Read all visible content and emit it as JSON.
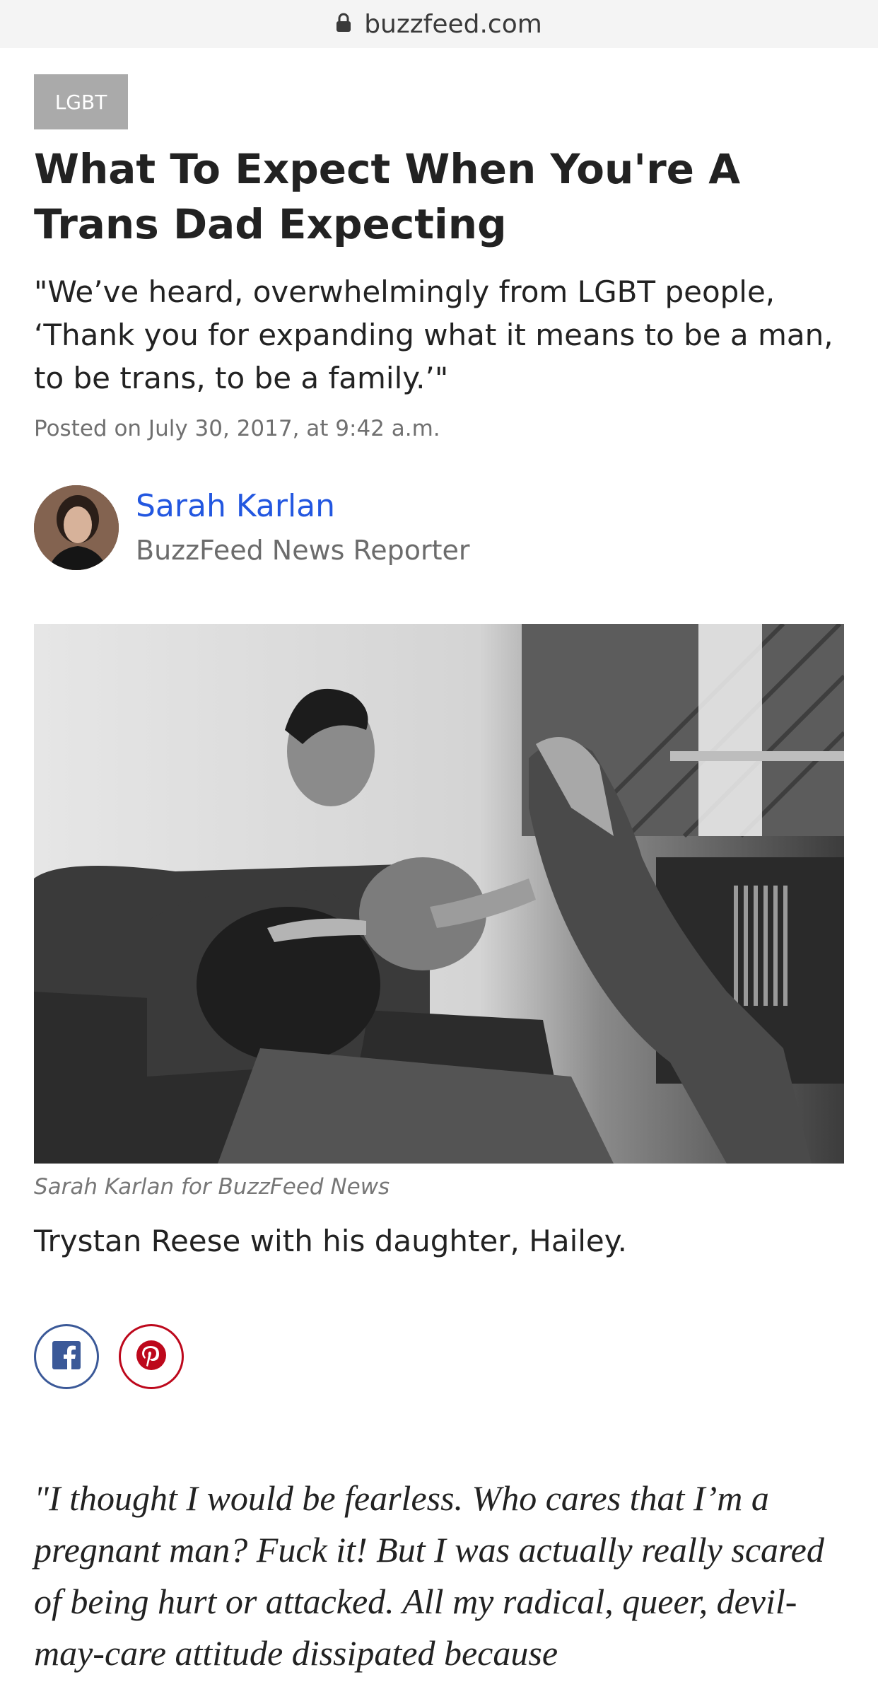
{
  "browser": {
    "url": "buzzfeed.com",
    "lock_icon": "lock-icon"
  },
  "article": {
    "category": "LGBT",
    "headline": "What To Expect When You're A Trans Dad Expecting",
    "dek": "\"We’ve heard, overwhelmingly from LGBT people, ‘Thank you for expanding what it means to be a man, to be trans, to be a family.’\"",
    "posted": "Posted on July 30, 2017, at 9:42 a.m.",
    "author": {
      "name": "Sarah Karlan",
      "role": "BuzzFeed News Reporter"
    },
    "photo": {
      "credit": "Sarah Karlan for BuzzFeed News",
      "caption": "Trystan Reese with his daughter, Hailey."
    },
    "share": [
      {
        "icon": "facebook-icon",
        "color": "#3b5998"
      },
      {
        "icon": "pinterest-icon",
        "color": "#bd081c"
      }
    ],
    "pull_quote": "\"I thought I would be fearless. Who cares that I’m a pregnant man? Fuck it! But I was actually really scared of being hurt or attacked. All my radical, queer, devil-may-care attitude dissipated because"
  },
  "colors": {
    "link": "#2357e0",
    "tag_bg": "#aaaaaa",
    "meta": "#707070"
  }
}
